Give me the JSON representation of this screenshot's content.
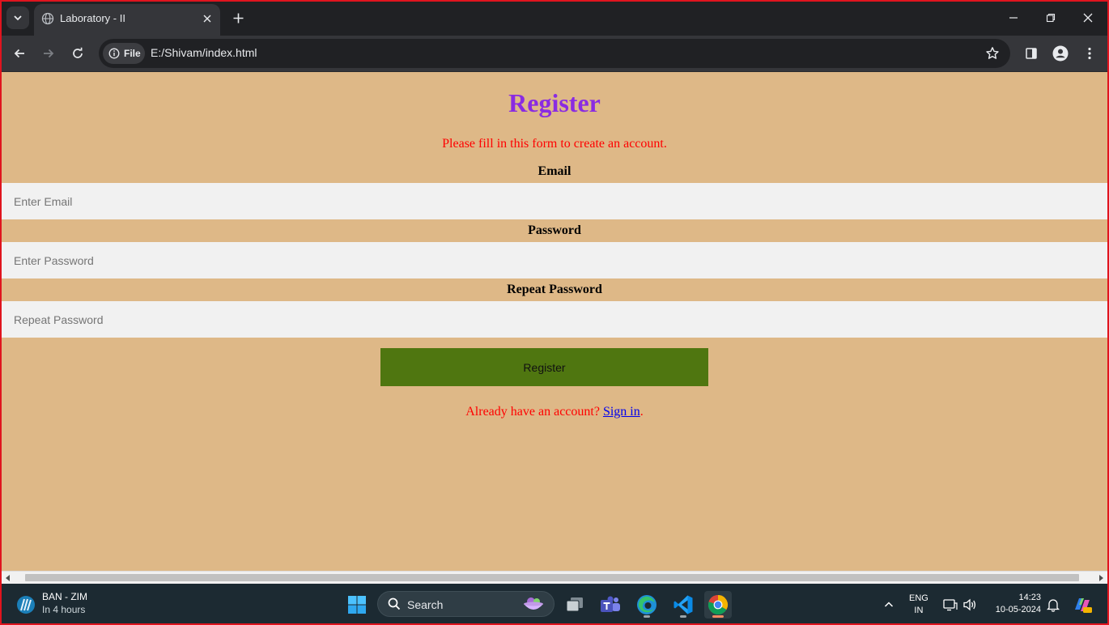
{
  "browser": {
    "tab_title": "Laboratory - II",
    "url_chip": "File",
    "url": "E:/Shivam/index.html"
  },
  "page": {
    "heading": "Register",
    "subtitle": "Please fill in this form to create an account.",
    "fields": [
      {
        "label": "Email",
        "placeholder": "Enter Email",
        "value": ""
      },
      {
        "label": "Password",
        "placeholder": "Enter Password",
        "value": ""
      },
      {
        "label": "Repeat Password",
        "placeholder": "Repeat Password",
        "value": ""
      }
    ],
    "register_button": "Register",
    "signin_prompt": "Already have an account? ",
    "signin_link": "Sign in",
    "signin_suffix": ".",
    "colors": {
      "background": "#deb887",
      "heading": "#8a2be2",
      "subtitle": "#ff0000",
      "button": "#4f7610",
      "input": "#f1f1f1",
      "link": "#0000ee"
    }
  },
  "taskbar": {
    "widget_title": "BAN - ZIM",
    "widget_subtitle": "In 4 hours",
    "search_label": "Search",
    "lang_primary": "ENG",
    "lang_secondary": "IN",
    "time": "14:23",
    "date": "10-05-2024"
  }
}
